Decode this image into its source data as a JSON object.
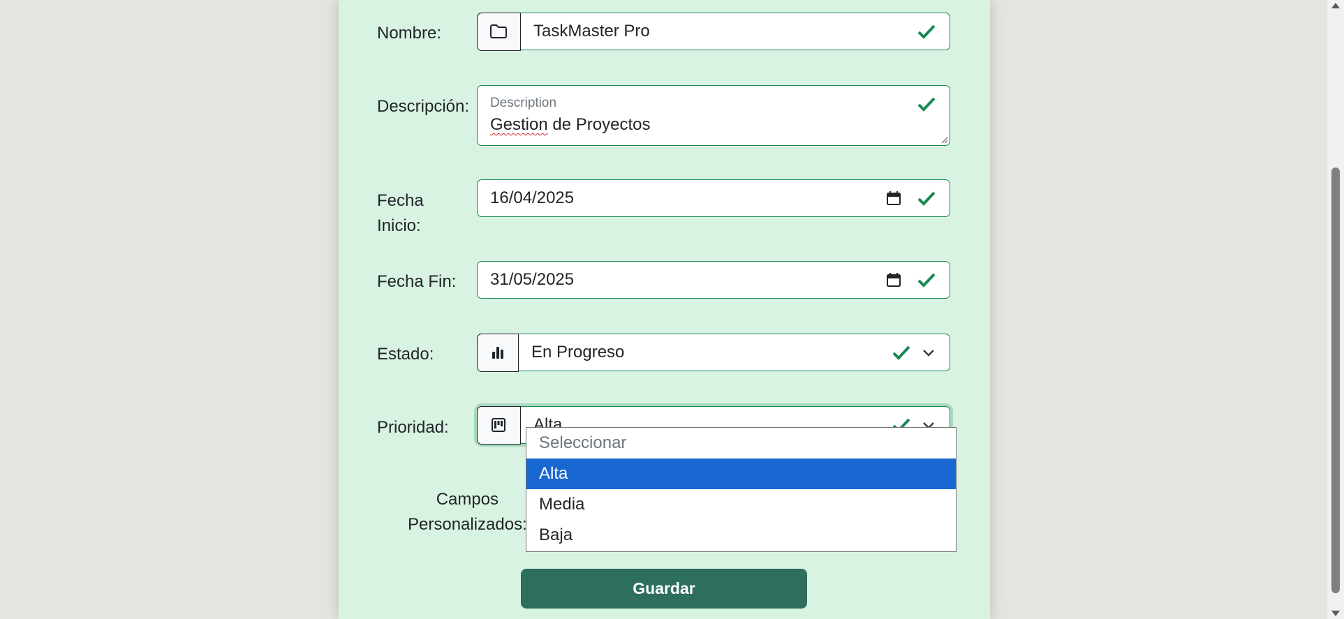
{
  "form": {
    "nombre": {
      "label": "Nombre:",
      "value": "TaskMaster Pro",
      "icon": "folder-icon"
    },
    "descripcion": {
      "label": "Descripción:",
      "floating_label": "Description",
      "value_word1": "Gestion",
      "value_rest": " de Proyectos"
    },
    "fecha_inicio": {
      "label_line1": "Fecha",
      "label_line2": "Inicio:",
      "value": "16/04/2025"
    },
    "fecha_fin": {
      "label": "Fecha Fin:",
      "value": "31/05/2025"
    },
    "estado": {
      "label": "Estado:",
      "value": "En Progreso",
      "icon": "bar-chart-icon"
    },
    "prioridad": {
      "label": "Prioridad:",
      "value": "Alta",
      "icon": "kanban-icon"
    },
    "campos": {
      "label_line1": "Campos",
      "label_line2": "Personalizados:"
    }
  },
  "dropdown": {
    "options": [
      "Seleccionar",
      "Alta",
      "Media",
      "Baja"
    ],
    "selected": "Alta"
  },
  "actions": {
    "save_label": "Guardar"
  },
  "colors": {
    "valid": "#198754",
    "panel": "#d9f3e2",
    "button": "#2e6e5e",
    "selection": "#1967d2"
  }
}
